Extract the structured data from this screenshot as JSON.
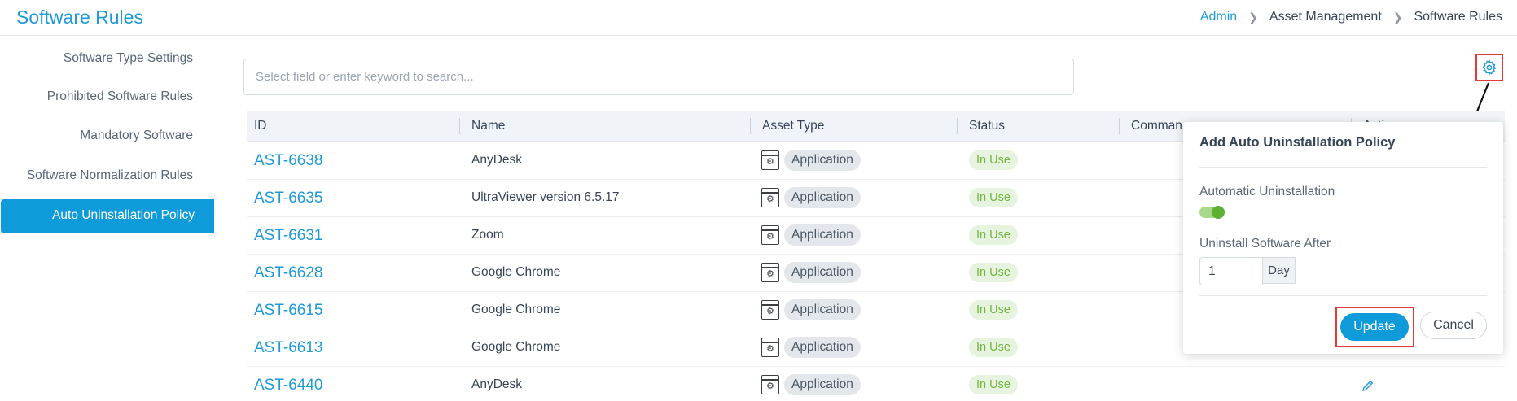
{
  "header": {
    "title": "Software Rules",
    "breadcrumb": [
      "Admin",
      "Asset Management",
      "Software Rules"
    ]
  },
  "sidebar": {
    "items": [
      {
        "label": "Software Type Settings"
      },
      {
        "label": "Prohibited Software Rules"
      },
      {
        "label": "Mandatory Software"
      },
      {
        "label": "Software Normalization Rules"
      },
      {
        "label": "Auto Uninstallation Policy"
      }
    ],
    "active": "Auto Uninstallation Policy"
  },
  "search": {
    "placeholder": "Select field or enter keyword to search...",
    "value": ""
  },
  "table": {
    "columns": [
      "ID",
      "Name",
      "Asset Type",
      "Status",
      "Comman",
      "Actio"
    ],
    "rows": [
      {
        "id": "AST-6638",
        "name": "AnyDesk",
        "asset_type": "Application",
        "status": "In Use"
      },
      {
        "id": "AST-6635",
        "name": "UltraViewer version 6.5.17",
        "asset_type": "Application",
        "status": "In Use"
      },
      {
        "id": "AST-6631",
        "name": "Zoom",
        "asset_type": "Application",
        "status": "In Use"
      },
      {
        "id": "AST-6628",
        "name": "Google Chrome",
        "asset_type": "Application",
        "status": "In Use"
      },
      {
        "id": "AST-6615",
        "name": "Google Chrome",
        "asset_type": "Application",
        "status": "In Use"
      },
      {
        "id": "AST-6613",
        "name": "Google Chrome",
        "asset_type": "Application",
        "status": "In Use"
      },
      {
        "id": "AST-6440",
        "name": "AnyDesk",
        "asset_type": "Application",
        "status": "In Use"
      }
    ]
  },
  "popup": {
    "title": "Add Auto Uninstallation Policy",
    "auto_uninstall_label": "Automatic Uninstallation",
    "auto_uninstall_enabled": true,
    "uninstall_after_label": "Uninstall Software After",
    "uninstall_after_value": "1",
    "uninstall_after_unit": "Day",
    "update_label": "Update",
    "cancel_label": "Cancel"
  },
  "colors": {
    "accent": "#0f9ad9",
    "highlight": "#e53935",
    "status_green": "#72b43f"
  },
  "icons": {
    "settings": "gear-icon",
    "asset_type": "application-icon",
    "edit": "pencil-icon"
  }
}
